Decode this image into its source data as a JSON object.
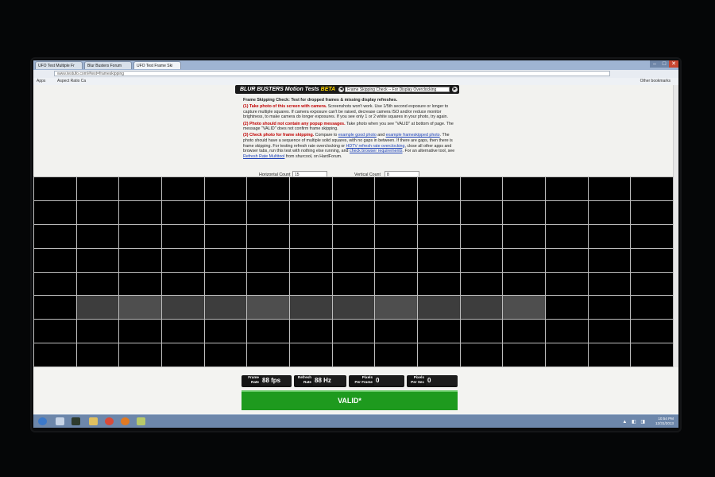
{
  "browser": {
    "tabs": [
      "UFO Test Multiple Fr",
      "Blur Busters Forum",
      "UFO Test Frame Ski"
    ],
    "url": "www.testufo.com/#test=frameskipping",
    "bookmarks": [
      "Apps",
      "Aspect Ratio Ca",
      "Other bookmarks"
    ],
    "controls": {
      "minimize": "–",
      "maximize": "□",
      "close": "✕"
    }
  },
  "header": {
    "logo_text": "BLUR BUSTERS",
    "logo_sub": "Motion Tests",
    "logo_beta": "BETA",
    "test_select": "Frame Skipping Check -- For Display Overclocking",
    "prev_icon": "◀",
    "next_icon": "▶"
  },
  "instructions": {
    "title": "Frame Skipping Check: Test for dropped frames & missing display refreshes.",
    "step1_head": "(1) Take photo of this screen with camera.",
    "step1_body": " Screenshots won't work. Use 1/5th second exposure or longer to capture multiple squares. If camera exposure can't be raised, decrease camera ISO and/or reduce monitor brightness, to make camera do longer exposures. If you see only 1 or 2 white squares in your photo, try again.",
    "step2_head": "(2) Photo should not contain any popup messages.",
    "step2_body": " Take photo when you see \"VALID\" at bottom of page. The message \"VALID\" does not confirm frame skipping.",
    "step3_head": "(3) Check photo for frame skipping.",
    "step3_a": " Compare to ",
    "link_good": "example good photo",
    "step3_b": " and ",
    "link_skipped": "example frameskipped photo",
    "step3_c": ". The photo should have a sequence of multiple solid squares, with no gaps in between. If there are gaps, then there is frame skipping. For testing refresh rate overclocking or ",
    "link_hdtv": "HDTV refresh rate overclocking",
    "step3_d": ", close all other apps and browser tabs, run this test with nothing else running, and ",
    "link_browser": "check browser requirements",
    "step3_e": ". For an alternative tool, see ",
    "link_multitool": "Refresh Rate Multitool",
    "step3_f": " from shurcool, on HardForum."
  },
  "counts": {
    "horizontal_label": "Horizontal Count",
    "horizontal_value": "15",
    "vertical_label": "Vertical Count",
    "vertical_value": "8"
  },
  "grid": {
    "columns": 15,
    "rows": 8,
    "lit_row": 6,
    "lit_cells": [
      1,
      2,
      3,
      4,
      5,
      6,
      7,
      8,
      9,
      10,
      11
    ],
    "lit_bright": [
      2,
      5,
      8,
      11
    ]
  },
  "stats": {
    "frame_rate_label": "Frame\nRate",
    "frame_rate_value": "88 fps",
    "refresh_rate_label": "Refresh\nRate",
    "refresh_rate_value": "88 Hz",
    "pixels_per_frame_label": "Pixels\nPer Frame",
    "pixels_per_frame_value": "0",
    "pixels_per_sec_label": "Pixels\nPer Sec",
    "pixels_per_sec_value": "0"
  },
  "status": {
    "valid_text": "VALID*"
  },
  "taskbar": {
    "clock_time": "10:54 PM",
    "clock_date": "12/31/2013",
    "tray_icons": "▲ ◧ ◨"
  }
}
